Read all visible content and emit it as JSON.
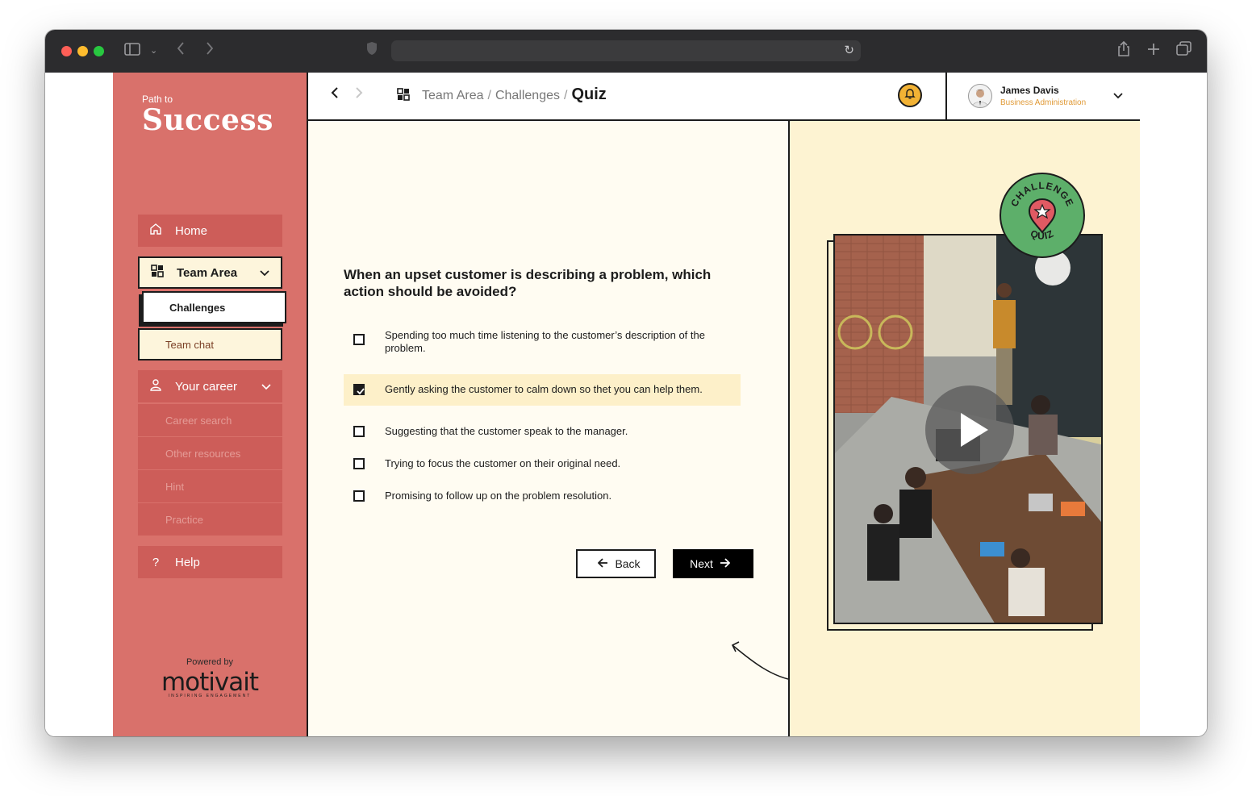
{
  "sidebar": {
    "brand_small": "Path to",
    "brand_big": "Success",
    "items": {
      "home": "Home",
      "team_area": "Team Area",
      "challenges": "Challenges",
      "team_chat": "Team chat",
      "your_career": "Your career",
      "career_search": "Career search",
      "other_resources": "Other resources",
      "hint": "Hint",
      "practice": "Practice",
      "help": "Help"
    },
    "powered_by": "Powered by",
    "logo": "motivait",
    "logo_tagline": "INSPIRING ENGAGEMENT"
  },
  "header": {
    "breadcrumb": [
      "Team Area",
      "Challenges",
      "Quiz"
    ],
    "user_name": "James Davis",
    "user_role": "Business Administration"
  },
  "quiz": {
    "question": "When an upset customer is describing a problem, which action should be avoided?",
    "options": [
      {
        "text": "Spending too much time listening to the customer’s description of the problem.",
        "checked": false
      },
      {
        "text": "Gently asking the customer to calm down so thet you can help them.",
        "checked": true
      },
      {
        "text": "Suggesting that the customer speak to the manager.",
        "checked": false
      },
      {
        "text": "Trying to focus the customer on their original need.",
        "checked": false
      },
      {
        "text": "Promising to follow up on the problem resolution.",
        "checked": false
      }
    ],
    "back_label": "Back",
    "next_label": "Next"
  },
  "badge": {
    "top_text": "CHALLENGE",
    "bottom_text": "QUIZ"
  },
  "colors": {
    "sidebar": "#d9716b",
    "nav_item": "#cd5d59",
    "cream": "#fdf5dc",
    "main_bg": "#fffcf2",
    "right_bg": "#fdf3d2",
    "bell": "#f2b234",
    "badge": "#5daf6a",
    "role_text": "#e09a37"
  },
  "icons": [
    "home-icon",
    "grid-icon",
    "chevron-down-icon",
    "user-icon",
    "help-icon",
    "bell-icon",
    "arrow-left-icon",
    "arrow-right-icon",
    "play-icon",
    "star-pin-icon"
  ]
}
